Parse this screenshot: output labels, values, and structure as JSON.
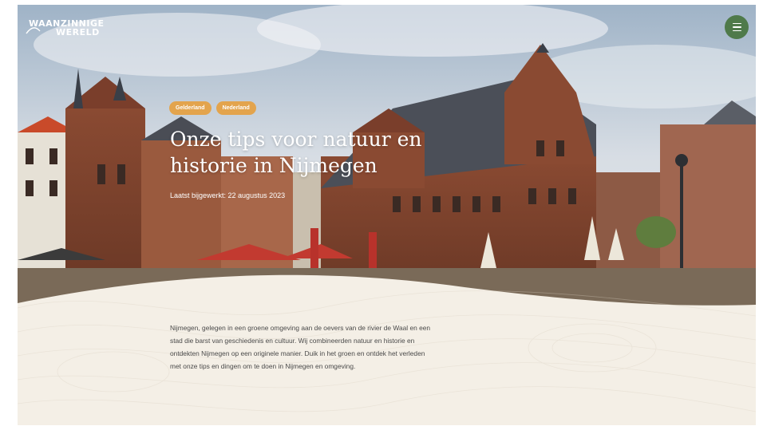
{
  "brand": {
    "logo_line1": "WAANZINNIGE",
    "logo_line2": "WERELD"
  },
  "header": {
    "menu_icon": "hamburger-menu-icon"
  },
  "tags": [
    "Gelderland",
    "Nederland"
  ],
  "article": {
    "title": "Onze tips voor natuur en historie in Nijmegen",
    "updated": "Laatst bijgewerkt: 22 augustus 2023",
    "intro": "Nijmegen, gelegen in een groene omgeving aan de oevers van de rivier de Waal en een stad die barst van geschiedenis en cultuur. Wij combineerden natuur en historie en ontdekten Nijmegen op een originele manier. Duik in het groen en ontdek het verleden met onze tips en dingen om te doen in Nijmegen en omgeving."
  },
  "colors": {
    "accent_green": "#4f7a4a",
    "tag_orange": "#e3a44d",
    "cream": "#f4efe6"
  }
}
